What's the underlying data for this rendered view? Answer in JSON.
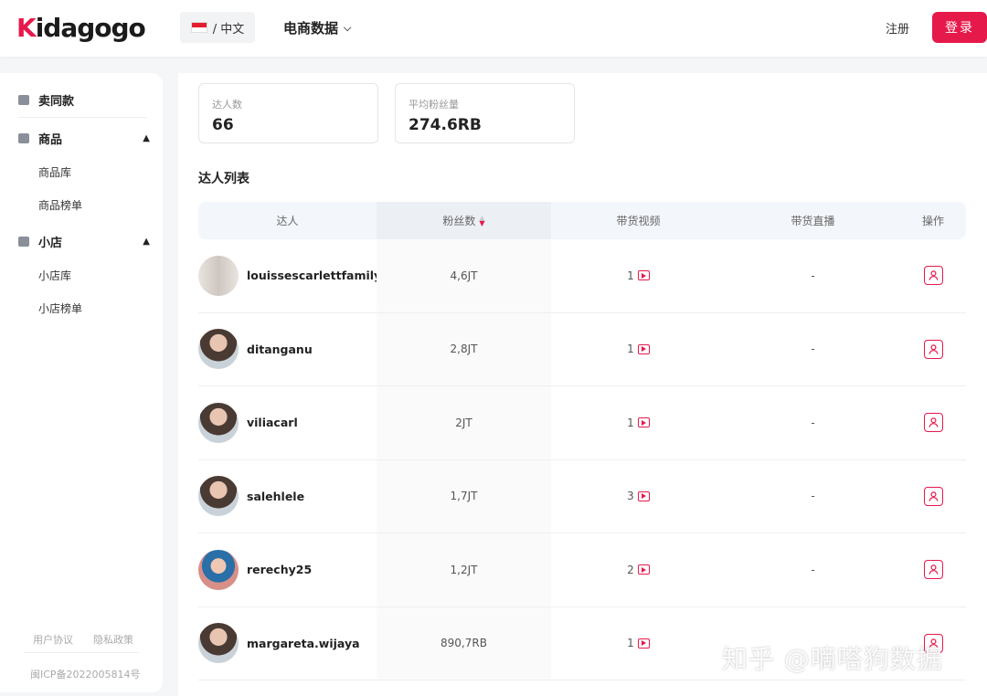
{
  "header": {
    "logo_prefix": "K",
    "logo_rest": "idagogo",
    "language": "/ 中文",
    "menu": "电商数据",
    "register": "注册",
    "login": "登录"
  },
  "sidebar": {
    "sections": [
      {
        "label": "卖同款"
      },
      {
        "label": "商品",
        "items": [
          "商品库",
          "商品榜单"
        ]
      },
      {
        "label": "小店",
        "items": [
          "小店库",
          "小店榜单"
        ]
      }
    ],
    "footer": {
      "agreement": "用户协议",
      "privacy": "隐私政策",
      "icp": "闽ICP备2022005814号"
    }
  },
  "stats": [
    {
      "label": "达人数",
      "value": "66"
    },
    {
      "label": "平均粉丝量",
      "value": "274.6RB"
    }
  ],
  "list_title": "达人列表",
  "table": {
    "headers": [
      "达人",
      "粉丝数",
      "带货视频",
      "带货直播",
      "操作"
    ],
    "rows": [
      {
        "name": "louissescarlettfamily",
        "fans": "4,6JT",
        "videos": "1",
        "live": "-"
      },
      {
        "name": "ditanganu",
        "fans": "2,8JT",
        "videos": "1",
        "live": "-"
      },
      {
        "name": "viliacarl",
        "fans": "2JT",
        "videos": "1",
        "live": "-"
      },
      {
        "name": "salehlele",
        "fans": "1,7JT",
        "videos": "3",
        "live": "-"
      },
      {
        "name": "rerechy25",
        "fans": "1,2JT",
        "videos": "2",
        "live": "-"
      },
      {
        "name": "margareta.wijaya",
        "fans": "890,7RB",
        "videos": "1",
        "live": ""
      }
    ]
  },
  "watermark": "知乎 @嘀嗒狗数据",
  "colors": {
    "accent": "#e6194b"
  }
}
